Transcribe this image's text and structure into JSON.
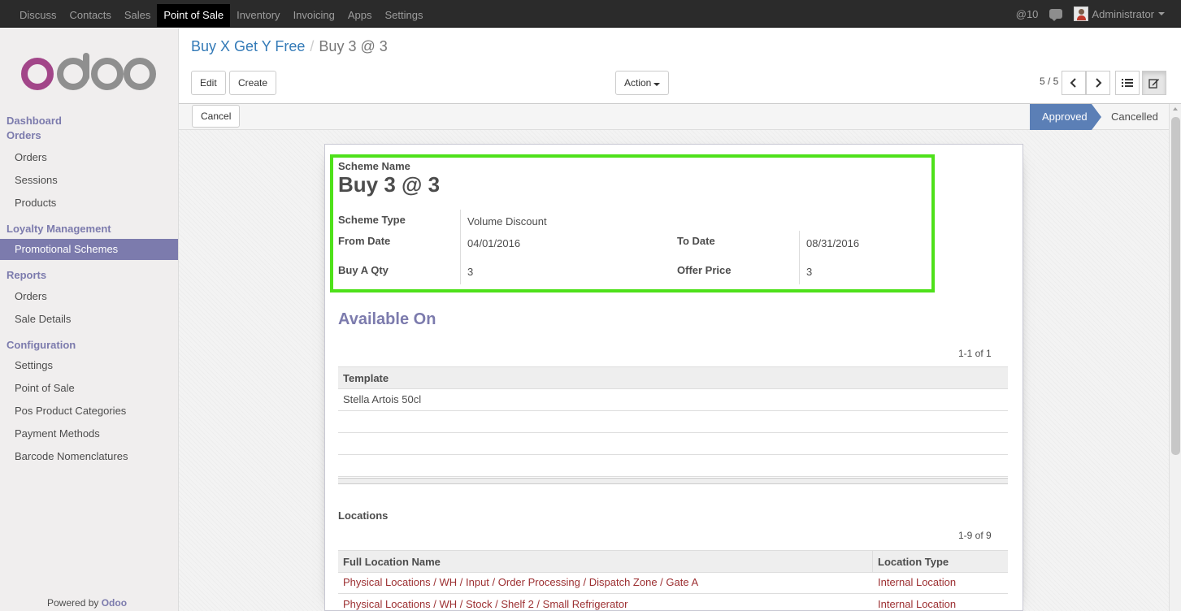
{
  "topbar": {
    "menu": [
      {
        "label": "Discuss",
        "active": false
      },
      {
        "label": "Contacts",
        "active": false
      },
      {
        "label": "Sales",
        "active": false
      },
      {
        "label": "Point of Sale",
        "active": true
      },
      {
        "label": "Inventory",
        "active": false
      },
      {
        "label": "Invoicing",
        "active": false
      },
      {
        "label": "Apps",
        "active": false
      },
      {
        "label": "Settings",
        "active": false
      }
    ],
    "notifications": "@10",
    "user": "Administrator"
  },
  "sidebar": {
    "logo_text": "odoo",
    "sections": [
      {
        "title": "Dashboard"
      },
      {
        "title": "Orders",
        "items": [
          "Orders",
          "Sessions",
          "Products"
        ]
      },
      {
        "title": "Loyalty Management",
        "items": [
          "Promotional Schemes"
        ]
      },
      {
        "title": "Reports",
        "items": [
          "Orders",
          "Sale Details"
        ]
      },
      {
        "title": "Configuration",
        "items": [
          "Settings",
          "Point of Sale",
          "Pos Product Categories",
          "Payment Methods",
          "Barcode Nomenclatures"
        ]
      }
    ],
    "active_item": "Promotional Schemes",
    "powered_by_prefix": "Powered by",
    "powered_by_brand": "Odoo"
  },
  "control_panel": {
    "breadcrumb_parent": "Buy X Get Y Free",
    "breadcrumb_separator": "/",
    "breadcrumb_current": "Buy 3 @ 3",
    "edit_label": "Edit",
    "create_label": "Create",
    "action_label": "Action",
    "pager": "5 / 5"
  },
  "statusbar": {
    "cancel_label": "Cancel",
    "stages": [
      "Approved",
      "Cancelled"
    ],
    "current_stage": "Approved"
  },
  "form": {
    "scheme_name_label": "Scheme Name",
    "scheme_name": "Buy 3 @ 3",
    "scheme_type_label": "Scheme Type",
    "scheme_type": "Volume Discount",
    "from_date_label": "From Date",
    "from_date": "04/01/2016",
    "to_date_label": "To Date",
    "to_date": "08/31/2016",
    "buy_qty_label": "Buy A Qty",
    "buy_qty": "3",
    "offer_price_label": "Offer Price",
    "offer_price": "3",
    "available_on_title": "Available On",
    "templates": {
      "count": "1-1 of 1",
      "header": "Template",
      "rows": [
        "Stella Artois 50cl"
      ]
    },
    "locations": {
      "title": "Locations",
      "count": "1-9 of 9",
      "headers": [
        "Full Location Name",
        "Location Type"
      ],
      "rows": [
        {
          "name": "Physical Locations / WH / Input / Order Processing / Dispatch Zone / Gate A",
          "type": "Internal Location"
        },
        {
          "name": "Physical Locations / WH / Stock / Shelf 2 / Small Refrigerator",
          "type": "Internal Location"
        }
      ]
    }
  },
  "colors": {
    "brand": "#7c7bad",
    "highlight": "#4ee11a",
    "status_active": "#5b7fb6",
    "link": "#9c2f31"
  }
}
